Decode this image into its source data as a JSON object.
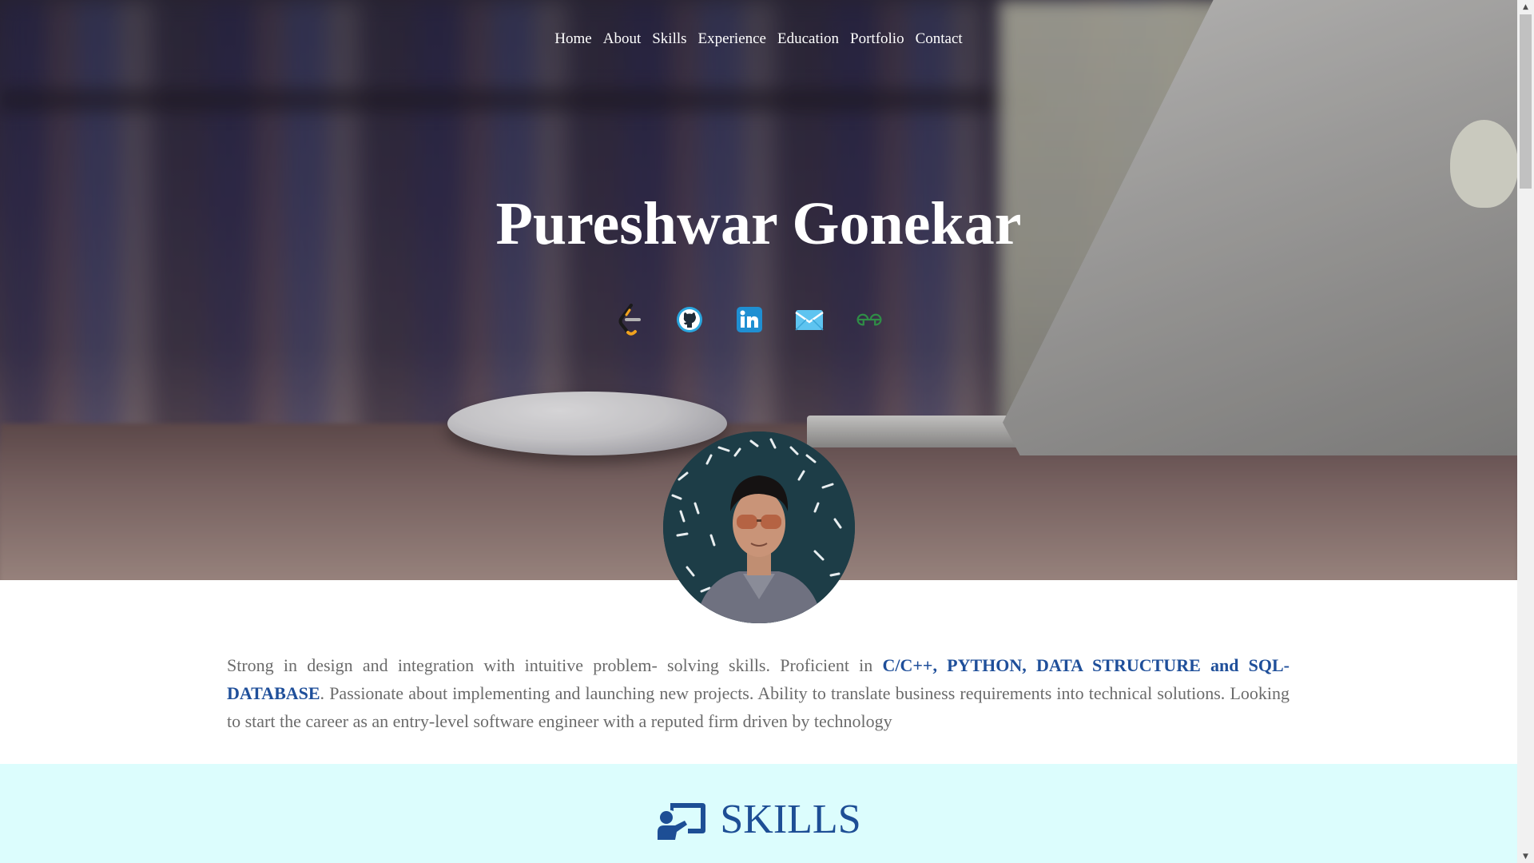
{
  "nav": {
    "items": [
      {
        "label": "Home"
      },
      {
        "label": "About"
      },
      {
        "label": "Skills"
      },
      {
        "label": "Experience"
      },
      {
        "label": "Education"
      },
      {
        "label": "Portfolio"
      },
      {
        "label": "Contact"
      }
    ]
  },
  "hero": {
    "name": "Pureshwar Gonekar",
    "socials": [
      {
        "icon": "leetcode-icon"
      },
      {
        "icon": "github-icon"
      },
      {
        "icon": "linkedin-icon"
      },
      {
        "icon": "mail-icon"
      },
      {
        "icon": "geeksforgeeks-icon"
      }
    ],
    "avatar_icon": "profile-photo"
  },
  "about": {
    "text_1": "Strong in design and integration with intuitive problem- solving skills. Proficient in ",
    "highlight": "C/C++, PYTHON, DATA STRUCTURE and SQL-DATABASE",
    "text_2": ". Passionate about implementing and launching new projects. Ability to translate business requirements into technical solutions. Looking to start the career as an entry-level software engineer with a reputed firm driven by technology"
  },
  "skills": {
    "title": "SKILLS",
    "icon": "chalkboard-teacher-icon"
  },
  "colors": {
    "accent": "#1f4f9a",
    "skills_bg": "#dcfdfd",
    "body_text": "#6b6b6b"
  }
}
